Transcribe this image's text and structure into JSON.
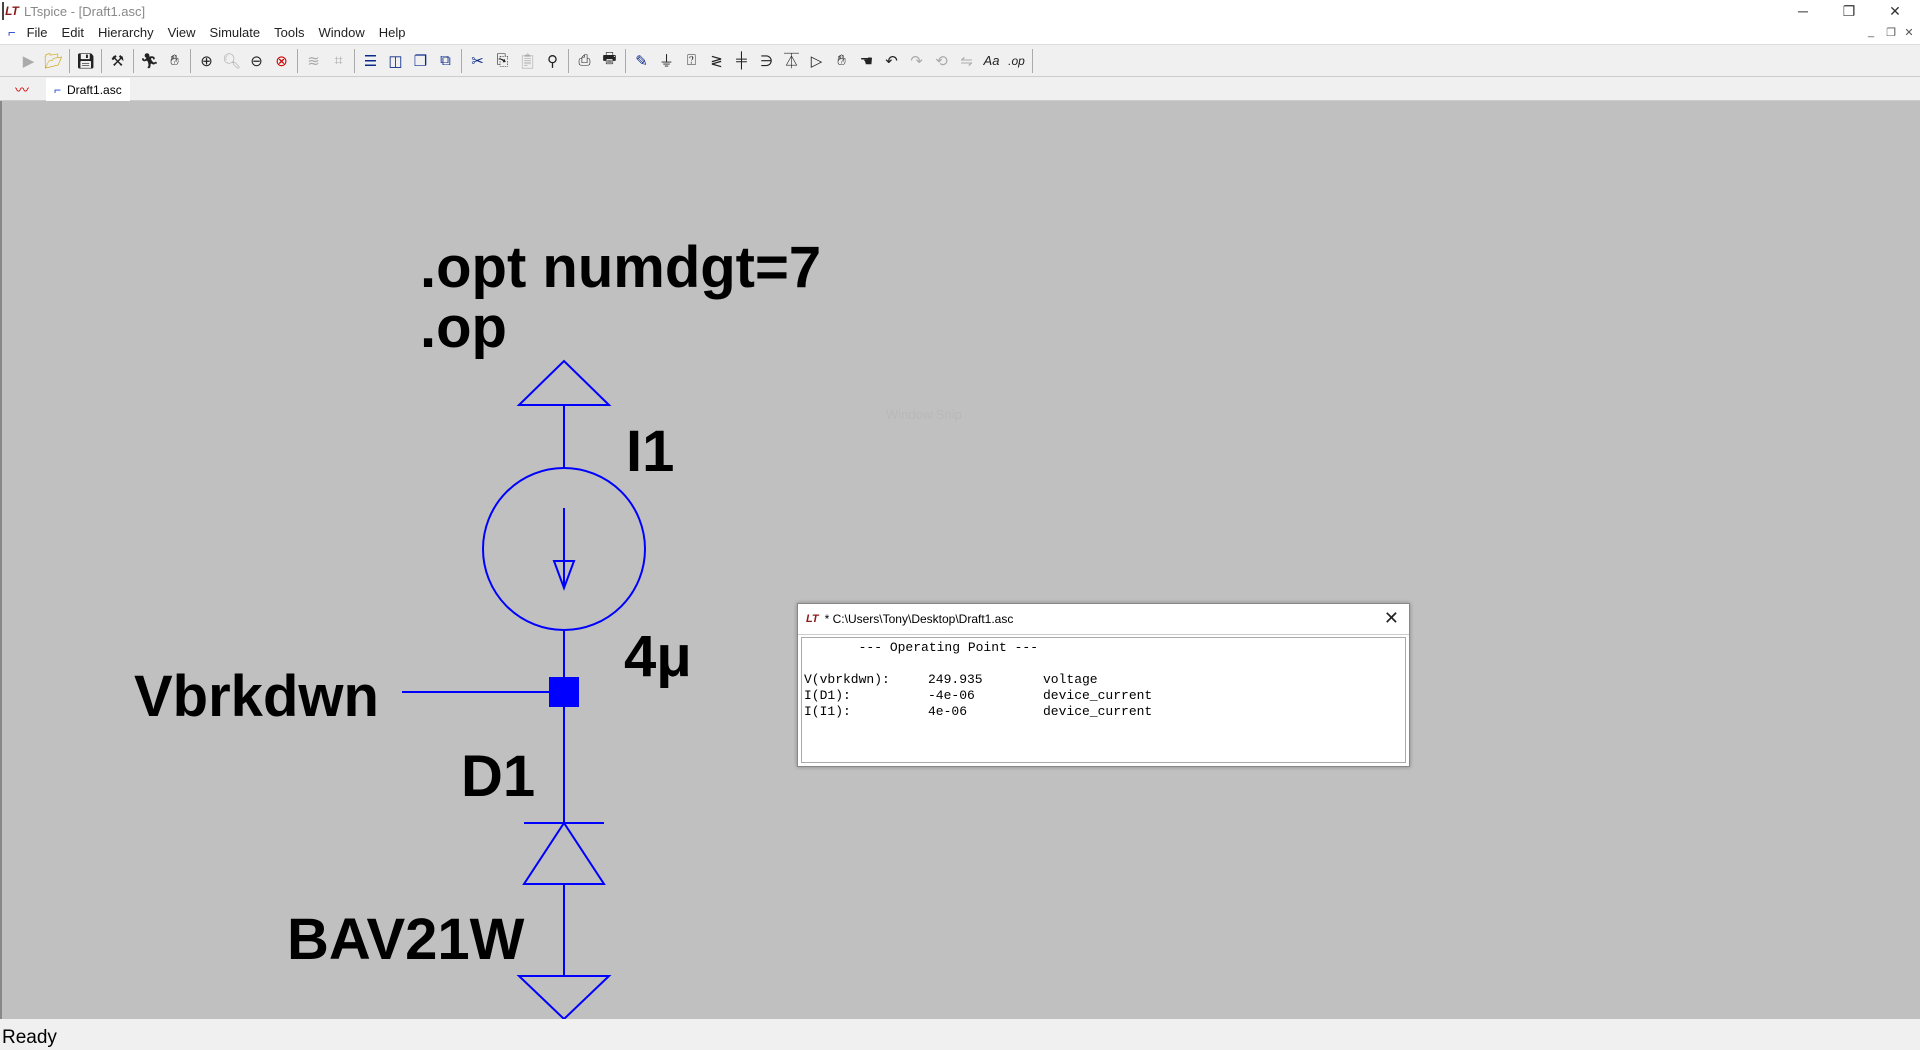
{
  "window": {
    "title": "LTspice - [Draft1.asc]",
    "minimize": "─",
    "restore": "❐",
    "close": "✕"
  },
  "menu": [
    "File",
    "Edit",
    "Hierarchy",
    "View",
    "Simulate",
    "Tools",
    "Window",
    "Help"
  ],
  "toolbar_icons": [
    "run-icon",
    "open-icon",
    "save-icon",
    "control-panel-icon",
    "halt-icon",
    "pan-icon",
    "zoom-in-icon",
    "zoom-fit-icon",
    "zoom-out-icon",
    "zoom-cancel-icon",
    "autorange-icon",
    "grid-icon",
    "tile-horizontal-icon",
    "tile-vertical-icon",
    "cascade-icon",
    "close-windows-icon",
    "cut-icon",
    "copy-icon",
    "paste-icon",
    "find-icon",
    "print-setup-icon",
    "print-icon",
    "wire-icon",
    "ground-icon",
    "label-net-icon",
    "resistor-icon",
    "capacitor-icon",
    "inductor-icon",
    "diode-icon",
    "component-icon",
    "move-icon",
    "drag-icon",
    "undo-icon",
    "redo-icon",
    "rotate-icon",
    "mirror-icon",
    "text-icon",
    "spice-directive-icon"
  ],
  "tabs": {
    "active": "Draft1.asc"
  },
  "schematic": {
    "directive1": ".opt numdgt=7",
    "directive2": ".op",
    "source_name": "I1",
    "source_value": "4μ",
    "net_label": "Vbrkdwn",
    "diode_name": "D1",
    "diode_model": "BAV21W",
    "wire_color": "#0000ff",
    "overlay": "Window Snip"
  },
  "dialog": {
    "title": "* C:\\Users\\Tony\\Desktop\\Draft1.asc",
    "header": "       --- Operating Point ---",
    "rows": [
      {
        "name": "V(vbrkdwn):",
        "value": "249.935",
        "type": "voltage"
      },
      {
        "name": "I(D1):",
        "value": "-4e-06",
        "type": "device_current"
      },
      {
        "name": "I(I1):",
        "value": "4e-06",
        "type": "device_current"
      }
    ]
  },
  "status": "Ready"
}
